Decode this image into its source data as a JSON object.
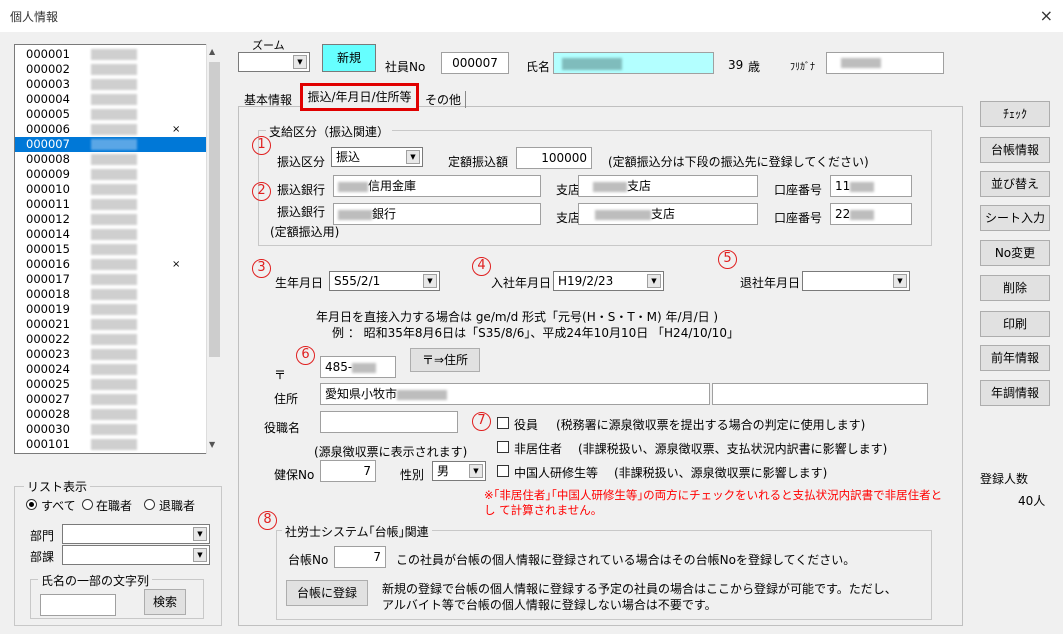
{
  "window": {
    "title": "個人情報",
    "close": "×"
  },
  "list": {
    "rows": [
      {
        "id": "000001",
        "mark": ""
      },
      {
        "id": "000002",
        "mark": ""
      },
      {
        "id": "000003",
        "mark": ""
      },
      {
        "id": "000004",
        "mark": ""
      },
      {
        "id": "000005",
        "mark": ""
      },
      {
        "id": "000006",
        "mark": "×"
      },
      {
        "id": "000007",
        "mark": "",
        "selected": true
      },
      {
        "id": "000008",
        "mark": ""
      },
      {
        "id": "000009",
        "mark": ""
      },
      {
        "id": "000010",
        "mark": ""
      },
      {
        "id": "000011",
        "mark": ""
      },
      {
        "id": "000012",
        "mark": ""
      },
      {
        "id": "000014",
        "mark": ""
      },
      {
        "id": "000015",
        "mark": ""
      },
      {
        "id": "000016",
        "mark": "×"
      },
      {
        "id": "000017",
        "mark": ""
      },
      {
        "id": "000018",
        "mark": ""
      },
      {
        "id": "000019",
        "mark": ""
      },
      {
        "id": "000021",
        "mark": ""
      },
      {
        "id": "000022",
        "mark": ""
      },
      {
        "id": "000023",
        "mark": ""
      },
      {
        "id": "000024",
        "mark": ""
      },
      {
        "id": "000025",
        "mark": ""
      },
      {
        "id": "000027",
        "mark": ""
      },
      {
        "id": "000028",
        "mark": ""
      },
      {
        "id": "000030",
        "mark": ""
      },
      {
        "id": "000101",
        "mark": ""
      }
    ]
  },
  "filter": {
    "legend": "リスト表示",
    "all": "すべて",
    "active": "在職者",
    "retired": "退職者",
    "dept": "部門",
    "section": "部課",
    "name_legend": "氏名の一部の文字列",
    "search": "検索"
  },
  "header": {
    "zoom": "ズーム",
    "new": "新規",
    "emp_no_label": "社員No",
    "emp_no": "000007",
    "name_label": "氏名",
    "age": "39",
    "age_unit": "歳",
    "kana_label": "ﾌﾘｶﾞﾅ"
  },
  "tabs": [
    "基本情報",
    "振込/年月日/住所等",
    "その他"
  ],
  "pay": {
    "legend": "支給区分（振込関連）",
    "kubun_label": "振込区分",
    "kubun": "振込",
    "teigaku_label": "定額振込額",
    "teigaku": "100000",
    "note": "(定額振込分は下段の振込先に登録してください)",
    "bank_label": "振込銀行",
    "bank1": "信用金庫",
    "branch_label": "支店",
    "branch1": "支店",
    "acct_label": "口座番号",
    "acct1": "11",
    "bank2": "銀行",
    "branch2": "支店",
    "acct2": "22",
    "teigaku_note": "(定額振込用)"
  },
  "dates": {
    "birth_label": "生年月日",
    "birth": "S55/2/1",
    "join_label": "入社年月日",
    "join": "H19/2/23",
    "retire_label": "退社年月日",
    "retire": "",
    "help1": "年月日を直接入力する場合は ge/m/d  形式「元号(H・S・T・M)  年/月/日 )",
    "help2": "例 ： 昭和35年8月6日は「S35/8/6」、平成24年10月10日 「H24/10/10」"
  },
  "address": {
    "zip_label": "〒",
    "zip": "485-",
    "zip_btn": "〒⇒住所",
    "addr_label": "住所",
    "addr1": "愛知県小牧市",
    "addr2": ""
  },
  "misc": {
    "post_label": "役職名",
    "post": "",
    "post_note": "(源泉徴収票に表示されます)",
    "kenpo_label": "健保No",
    "kenpo": "7",
    "sex_label": "性別",
    "sex": "男",
    "c1": "役員",
    "c1n": "(税務署に源泉徴収票を提出する場合の判定に使用します)",
    "c2": "非居住者",
    "c2n": "(非課税扱い、源泉徴収票、支払状況内訳書に影響します)",
    "c3": "中国人研修生等",
    "c3n": "(非課税扱い、源泉徴収票に影響します)",
    "warn": "※｢非居住者｣｢中国人研修生等｣の両方にチェックをいれると支払状況内訳書で非居住者とし て計算されません。"
  },
  "labor": {
    "legend": "社労士システム｢台帳｣関連",
    "no_label": "台帳No",
    "no": "7",
    "note1": "この社員が台帳の個人情報に登録されている場合はその台帳Noを登録してください。",
    "btn": "台帳に登録",
    "note2": "新規の登録で台帳の個人情報に登録する予定の社員の場合はここから登録が可能です。ただし、",
    "note3": "アルバイト等で台帳の個人情報に登録しない場合は不要です。"
  },
  "side": [
    "ﾁｪｯｸ",
    "台帳情報",
    "並び替え",
    "シート入力",
    "No変更",
    "削除",
    "印刷",
    "前年情報",
    "年調情報"
  ],
  "count": {
    "label": "登録人数",
    "value": "40人"
  },
  "markers": [
    "1",
    "2",
    "3",
    "4",
    "5",
    "6",
    "7",
    "8"
  ],
  "colors": {
    "selection": "#0078d7",
    "name_bg": "#b3ffff",
    "new_btn": "#66ffff",
    "marker": "#e02020",
    "tab_highlight": "#e00000"
  }
}
